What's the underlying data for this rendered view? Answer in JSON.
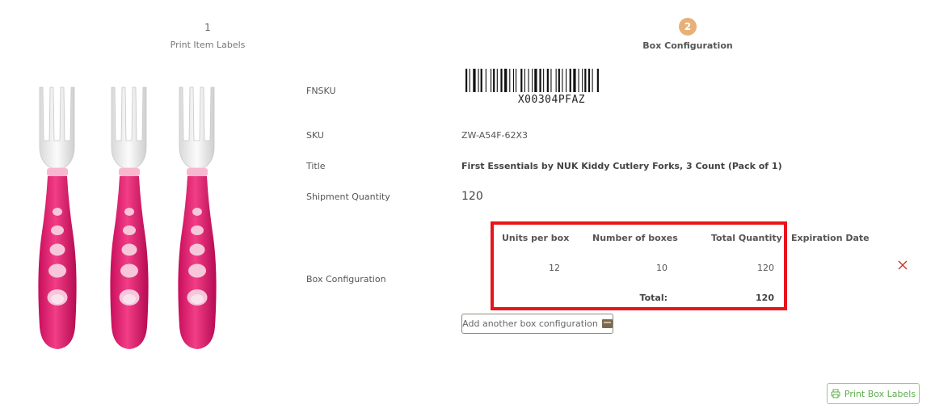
{
  "stepper": {
    "step1": {
      "number": "1",
      "label": "Print Item Labels"
    },
    "step2": {
      "number": "2",
      "label": "Box Configuration"
    },
    "active_color": "#e8b079"
  },
  "product": {
    "image_icon": "kids-forks-image",
    "fnsku_label": "FNSKU",
    "fnsku_value": "X0030 4PFAZ",
    "barcode_text": "X00304PFAZ",
    "sku_label": "SKU",
    "sku_value": "ZW-A54F-62X3",
    "title_label": "Title",
    "title_value": "First Essentials by NUK Kiddy Cutlery Forks, 3 Count (Pack of 1)",
    "shipment_qty_label": "Shipment Quantity",
    "shipment_qty_value": "120",
    "box_config_label": "Box Configuration"
  },
  "box_table": {
    "headers": {
      "units_per_box": "Units per box",
      "number_of_boxes": "Number of boxes",
      "total_quantity": "Total Quantity",
      "expiration_date": "Expiration Date"
    },
    "rows": [
      {
        "units_per_box": "12",
        "number_of_boxes": "10",
        "total_quantity": "120",
        "expiration_date": ""
      }
    ],
    "total_label": "Total:",
    "total_value": "120",
    "highlight_color": "#e8141b"
  },
  "buttons": {
    "add_box_config": "Add another box configuration",
    "print_box_labels": "Print Box Labels",
    "remove_icon": "close-icon"
  }
}
